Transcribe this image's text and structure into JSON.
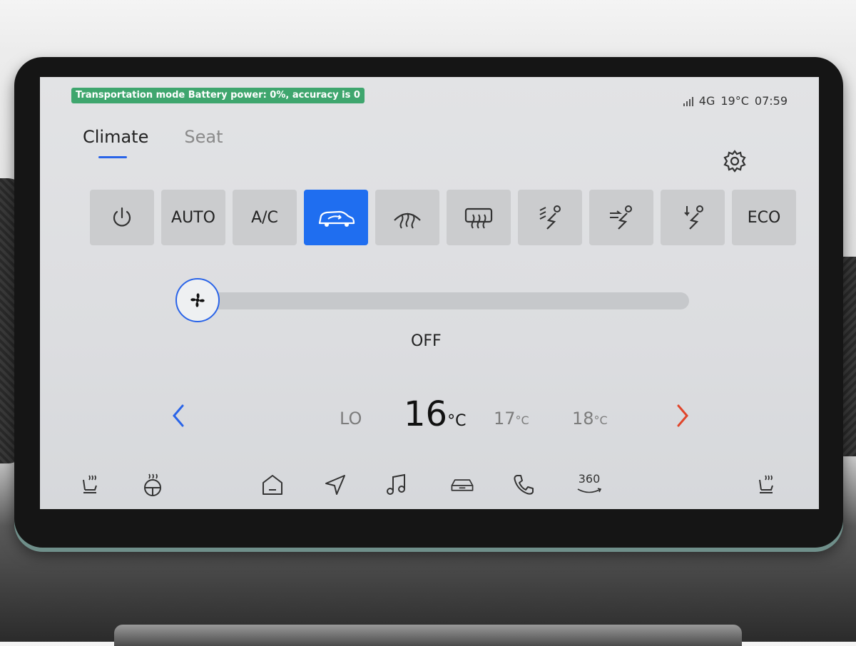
{
  "status": {
    "banner": "Transportation mode Battery power: 0%, accuracy is 0",
    "network": "4G",
    "temperature": "19°C",
    "time": "07:59"
  },
  "tabs": [
    {
      "label": "Climate",
      "active": true
    },
    {
      "label": "Seat",
      "active": false
    }
  ],
  "controls": {
    "power": "power-icon",
    "auto": "AUTO",
    "ac": "A/C",
    "recirculation": "car-recirculation-icon",
    "front_defrost": "front-defrost-icon",
    "rear_defrost": "rear-defrost-icon",
    "airflow_windshield_face": "airflow-windshield-icon",
    "airflow_face": "airflow-face-icon",
    "airflow_feet": "airflow-feet-icon",
    "eco": "ECO"
  },
  "fan": {
    "status_label": "OFF",
    "level_fraction": 0
  },
  "temperature_selector": {
    "options": [
      "LO",
      "16",
      "17",
      "18"
    ],
    "unit": "°C",
    "selected": "16"
  },
  "bottom_nav": {
    "seat_heat_left": "seat-heat-icon",
    "steering_heat": "steering-heat-icon",
    "home": "home-icon",
    "navigation": "navigation-icon",
    "music": "music-icon",
    "vehicle": "car-icon",
    "phone": "phone-icon",
    "camera_360": "360",
    "seat_heat_right": "seat-heat-icon"
  },
  "colors": {
    "accent": "#1f6ef0",
    "banner": "#3fa66e",
    "next_arrow": "#e0452b",
    "prev_arrow": "#2a64e8"
  }
}
